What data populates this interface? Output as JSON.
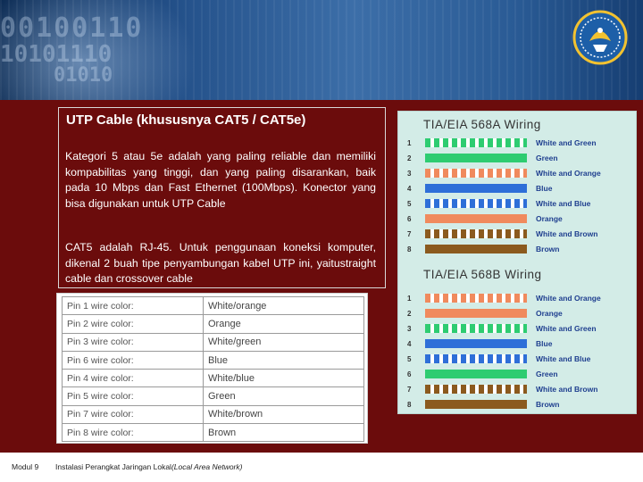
{
  "header": {
    "binary_lines": [
      "00100110",
      "10101110",
      "01010"
    ],
    "logo_icon": "tut-wuri-handayani-emblem-icon"
  },
  "content": {
    "title": "UTP Cable (khususnya CAT5 / CAT5e)",
    "paragraphs": [
      "Kategori 5 atau 5e adalah yang paling reliable dan memiliki kompabilitas yang tinggi, dan yang paling disarankan, baik pada 10 Mbps dan Fast Ethernet (100Mbps). Konector yang bisa digunakan untuk UTP Cable",
      "CAT5 adalah RJ-45. Untuk penggunaan koneksi komputer, dikenal 2 buah tipe penyambungan kabel UTP ini, yaitustraight cable dan crossover cable"
    ]
  },
  "pin_table": [
    {
      "pin": "Pin 1 wire color:",
      "color": "White/orange"
    },
    {
      "pin": "Pin 2 wire color:",
      "color": "Orange"
    },
    {
      "pin": "Pin 3 wire color:",
      "color": "White/green"
    },
    {
      "pin": "Pin 6 wire color:",
      "color": "Blue"
    },
    {
      "pin": "Pin 4 wire color:",
      "color": "White/blue"
    },
    {
      "pin": "Pin 5 wire color:",
      "color": "Green"
    },
    {
      "pin": "Pin 7 wire color:",
      "color": "White/brown"
    },
    {
      "pin": "Pin 8 wire color:",
      "color": "Brown"
    }
  ],
  "wiring": {
    "title_a": "TIA/EIA 568A Wiring",
    "title_b": "TIA/EIA 568B Wiring",
    "a": [
      {
        "num": "1",
        "label": "White and Green",
        "color": "#2ecc71",
        "striped": true
      },
      {
        "num": "2",
        "label": "Green",
        "color": "#2ecc71",
        "striped": false
      },
      {
        "num": "3",
        "label": "White and Orange",
        "color": "#f08a5d",
        "striped": true
      },
      {
        "num": "4",
        "label": "Blue",
        "color": "#2e6fd8",
        "striped": false
      },
      {
        "num": "5",
        "label": "White and Blue",
        "color": "#2e6fd8",
        "striped": true
      },
      {
        "num": "6",
        "label": "Orange",
        "color": "#f08a5d",
        "striped": false
      },
      {
        "num": "7",
        "label": "White and Brown",
        "color": "#8b5a1e",
        "striped": true
      },
      {
        "num": "8",
        "label": "Brown",
        "color": "#8b5a1e",
        "striped": false
      }
    ],
    "b": [
      {
        "num": "1",
        "label": "White and Orange",
        "color": "#f08a5d",
        "striped": true
      },
      {
        "num": "2",
        "label": "Orange",
        "color": "#f08a5d",
        "striped": false
      },
      {
        "num": "3",
        "label": "White and Green",
        "color": "#2ecc71",
        "striped": true
      },
      {
        "num": "4",
        "label": "Blue",
        "color": "#2e6fd8",
        "striped": false
      },
      {
        "num": "5",
        "label": "White and Blue",
        "color": "#2e6fd8",
        "striped": true
      },
      {
        "num": "6",
        "label": "Green",
        "color": "#2ecc71",
        "striped": false
      },
      {
        "num": "7",
        "label": "White and Brown",
        "color": "#8b5a1e",
        "striped": true
      },
      {
        "num": "8",
        "label": "Brown",
        "color": "#8b5a1e",
        "striped": false
      }
    ]
  },
  "footer": {
    "module": "Modul 9",
    "course": "Instalasi Perangkat Jaringan Lokal",
    "course_italic": "(Local Area Network)"
  }
}
